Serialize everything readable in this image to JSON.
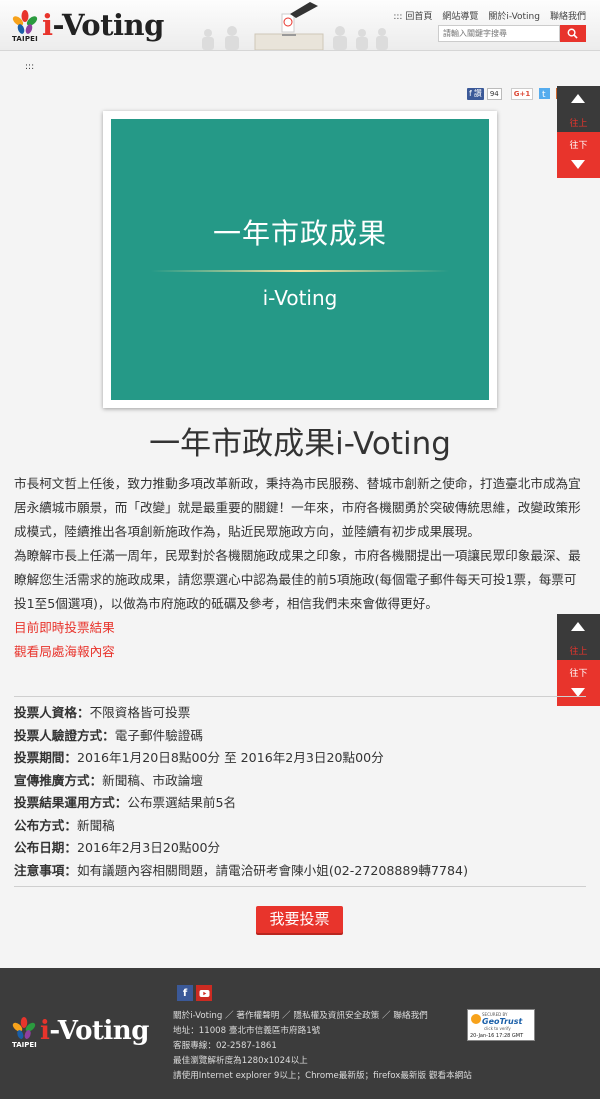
{
  "header": {
    "logo_taipei": "TAIPEI",
    "logo_text": "i-Voting",
    "nav": [
      "::: 回首頁",
      "網站導覽",
      "關於i-Voting",
      "聯絡我們"
    ],
    "search_placeholder": "請輸入關鍵字搜尋"
  },
  "accesskey": ":::",
  "share": {
    "fb_label": "讚",
    "fb_count": "94",
    "gplus_label": "G+1"
  },
  "scroll_widgets": [
    {
      "up_label": "往上",
      "down_label": "往下"
    },
    {
      "up_label": "往上",
      "down_label": "往下"
    }
  ],
  "banner": {
    "title": "一年市政成果",
    "subtitle": "i-Voting"
  },
  "page_title": "一年市政成果i-Voting",
  "article": {
    "para1": "市長柯文哲上任後，致力推動多項改革新政，秉持為市民服務、替城市創新之使命，打造臺北市成為宜居永續城市願景，而「改變」就是最重要的關鍵！一年來，市府各機關勇於突破傳統思維，改變政策形成模式，陸續推出各項創新施政作為，貼近民眾施政方向，並陸續有初步成果展現。",
    "para2": "為瞭解市長上任滿一周年，民眾對於各機關施政成果之印象，市府各機關提出一項讓民眾印象最深、最瞭解您生活需求的施政成果，請您票選心中認為最佳的前5項施政(每個電子郵件每天可投1票，每票可投1至5個選項)，以做為市府施政的砥礪及參考，相信我們未來會做得更好。",
    "link1": "目前即時投票結果",
    "link2": "觀看局處海報內容"
  },
  "info": [
    {
      "label": "投票人資格：",
      "value": "不限資格皆可投票"
    },
    {
      "label": "投票人驗證方式：",
      "value": "電子郵件驗證碼"
    },
    {
      "label": "投票期間：",
      "value": "2016年1月20日8點00分 至 2016年2月3日20點00分"
    },
    {
      "label": "宣傳推廣方式：",
      "value": "新聞稿、市政論壇"
    },
    {
      "label": "投票結果運用方式：",
      "value": "公布票選結果前5名"
    },
    {
      "label": "公布方式：",
      "value": "新聞稿"
    },
    {
      "label": "公布日期：",
      "value": "2016年2月3日20點00分"
    },
    {
      "label": "注意事項：",
      "value": "如有議題內容相關問題，請電洽研考會陳小姐(02-27208889轉7784)"
    }
  ],
  "vote_button": "我要投票",
  "footer": {
    "logo_taipei": "TAIPEI",
    "logo_text": "i-Voting",
    "links": "關於i-Voting ／ 著作權聲明 ／ 隱私權及資訊安全政策 ／ 聯絡我們",
    "address": "地址：11008 臺北市信義區市府路1號",
    "phone": "客服專線：02-2587-1861",
    "resolution": "最佳瀏覽解析度為1280x1024以上",
    "browser": "請使用Internet explorer 9以上；Chrome最新版；firefox最新版 觀看本網站",
    "geotrust": {
      "secured": "SECURED BY",
      "brand": "GeoTrust",
      "click": "click to verify",
      "date": "20-Jan-16 17:28 GMT"
    }
  },
  "colors": {
    "accent": "#e8342c",
    "banner_teal": "#259987",
    "footer_bg": "#3c3c3c"
  }
}
